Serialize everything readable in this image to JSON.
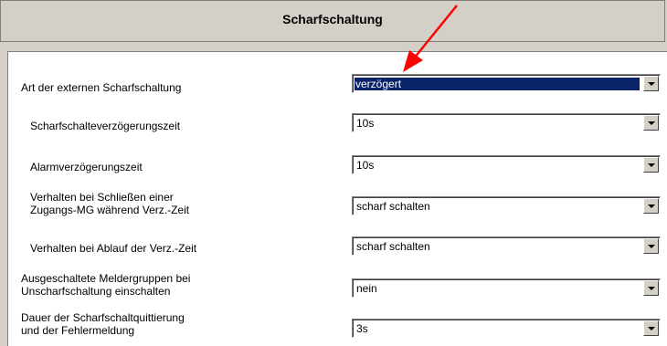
{
  "header": {
    "title": "Scharfschaltung"
  },
  "parameters": [
    {
      "label": "Art der externen Scharfschaltung",
      "value": "verzögert"
    },
    {
      "label": "Scharfschalteverzögerungszeit",
      "value": "10s"
    },
    {
      "label": "Alarmverzögerungszeit",
      "value": "10s"
    },
    {
      "label_line1": "Verhalten bei Schließen einer",
      "label_line2": "Zugangs-MG während Verz.-Zeit",
      "value": "scharf schalten"
    },
    {
      "label": "Verhalten bei Ablauf der Verz.-Zeit",
      "value": "scharf schalten"
    },
    {
      "label_line1": "Ausgeschaltete Meldergruppen bei",
      "label_line2": "Unscharfschaltung einschalten",
      "value": "nein"
    },
    {
      "label_line1": "Dauer der Scharfschaltquittierung",
      "label_line2": "und der Fehlermeldung",
      "value": "3s"
    }
  ],
  "colors": {
    "window_bg": "#d4d0c8",
    "selection_bg": "#0a246a",
    "annotation_arrow": "#ff0000"
  },
  "icons": {
    "dropdown": "chevron-down-icon",
    "annotation": "red-arrow-annotation"
  }
}
